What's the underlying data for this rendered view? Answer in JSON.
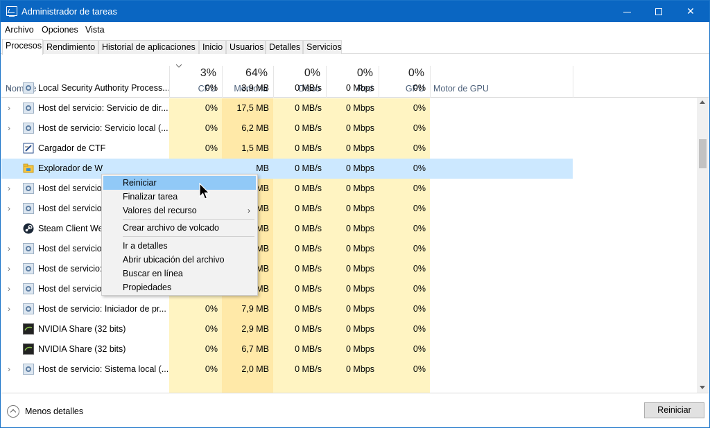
{
  "window": {
    "title": "Administrador de tareas",
    "accent": "#0a66c2"
  },
  "menu": [
    "Archivo",
    "Opciones",
    "Vista"
  ],
  "tabs": [
    "Procesos",
    "Rendimiento",
    "Historial de aplicaciones",
    "Inicio",
    "Usuarios",
    "Detalles",
    "Servicios"
  ],
  "header": {
    "name": "Nombre",
    "cpu_pct": "3%",
    "cpu": "CPU",
    "mem_pct": "64%",
    "mem": "Memoria",
    "disk_pct": "0%",
    "disk": "Disco",
    "net_pct": "0%",
    "net": "Red",
    "gpu_pct": "0%",
    "gpu": "GPU",
    "gpu_engine": "Motor de GPU"
  },
  "rows": [
    {
      "name": "Local Security Authority Process...",
      "cpu": "0%",
      "mem": "3,9 MB",
      "disk": "0 MB/s",
      "net": "0 Mbps",
      "gpu": "0%"
    },
    {
      "name": "Host del servicio: Servicio de dir...",
      "cpu": "0%",
      "mem": "17,5 MB",
      "disk": "0 MB/s",
      "net": "0 Mbps",
      "gpu": "0%"
    },
    {
      "name": "Host de servicio: Servicio local (...",
      "cpu": "0%",
      "mem": "6,2 MB",
      "disk": "0 MB/s",
      "net": "0 Mbps",
      "gpu": "0%"
    },
    {
      "name": "Cargador de CTF",
      "cpu": "0%",
      "mem": "1,5 MB",
      "disk": "0 MB/s",
      "net": "0 Mbps",
      "gpu": "0%"
    },
    {
      "name": "Explorador de W",
      "cpu": "",
      "mem": "MB",
      "disk": "0 MB/s",
      "net": "0 Mbps",
      "gpu": "0%"
    },
    {
      "name": "Host del servicio",
      "cpu": "",
      "mem": "MB",
      "disk": "0 MB/s",
      "net": "0 Mbps",
      "gpu": "0%"
    },
    {
      "name": "Host del servicio",
      "cpu": "",
      "mem": "MB",
      "disk": "0 MB/s",
      "net": "0 Mbps",
      "gpu": "0%"
    },
    {
      "name": "Steam Client We",
      "cpu": "",
      "mem": "MB",
      "disk": "0 MB/s",
      "net": "0 Mbps",
      "gpu": "0%"
    },
    {
      "name": "Host del servicio",
      "cpu": "",
      "mem": "MB",
      "disk": "0 MB/s",
      "net": "0 Mbps",
      "gpu": "0%"
    },
    {
      "name": "Host de servicio:",
      "cpu": "",
      "mem": "MB",
      "disk": "0 MB/s",
      "net": "0 Mbps",
      "gpu": "0%"
    },
    {
      "name": "Host del servicio: Optimización ...",
      "cpu": "0%",
      "mem": "3,7 MB",
      "disk": "0 MB/s",
      "net": "0 Mbps",
      "gpu": "0%"
    },
    {
      "name": "Host de servicio: Iniciador de pr...",
      "cpu": "0%",
      "mem": "7,9 MB",
      "disk": "0 MB/s",
      "net": "0 Mbps",
      "gpu": "0%"
    },
    {
      "name": "NVIDIA Share (32 bits)",
      "cpu": "0%",
      "mem": "2,9 MB",
      "disk": "0 MB/s",
      "net": "0 Mbps",
      "gpu": "0%"
    },
    {
      "name": "NVIDIA Share (32 bits)",
      "cpu": "0%",
      "mem": "6,7 MB",
      "disk": "0 MB/s",
      "net": "0 Mbps",
      "gpu": "0%"
    },
    {
      "name": "Host de servicio: Sistema local (...",
      "cpu": "0%",
      "mem": "2,0 MB",
      "disk": "0 MB/s",
      "net": "0 Mbps",
      "gpu": "0%"
    }
  ],
  "context_menu": {
    "restart": "Reiniciar",
    "end_task": "Finalizar tarea",
    "resource_values": "Valores del recurso",
    "create_dump": "Crear archivo de volcado",
    "go_details": "Ir a detalles",
    "open_location": "Abrir ubicación del archivo",
    "search_online": "Buscar en línea",
    "properties": "Propiedades"
  },
  "footer": {
    "less_details": "Menos detalles",
    "restart_button": "Reiniciar"
  }
}
